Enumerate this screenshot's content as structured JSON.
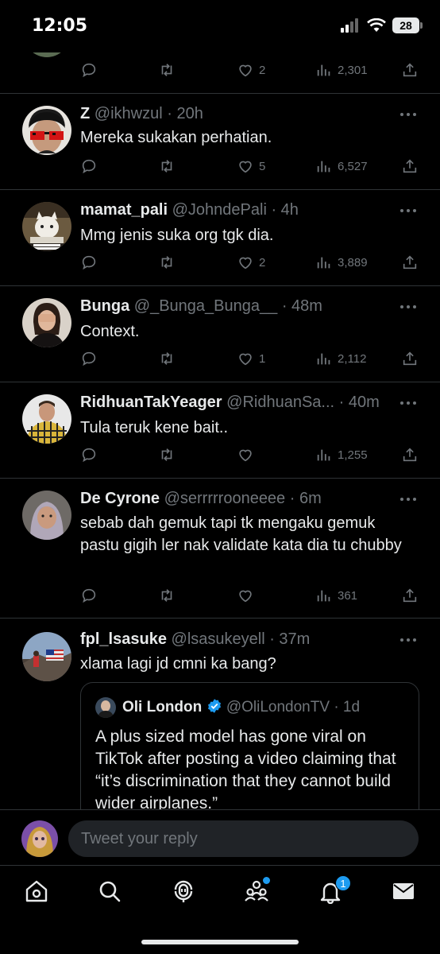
{
  "status": {
    "time": "12:05",
    "battery": "28"
  },
  "top_tweet": {
    "likes": "2",
    "views": "2,301"
  },
  "tweets": [
    {
      "name": "Z",
      "handle": "@ikhwzul",
      "time": "· 20h",
      "text": "Mereka sukakan perhatian.",
      "likes": "5",
      "views": "6,527"
    },
    {
      "name": "mamat_pali",
      "handle": "@JohndePali",
      "time": "· 4h",
      "text": "Mmg jenis suka org tgk dia.",
      "likes": "2",
      "views": "3,889"
    },
    {
      "name": "Bunga",
      "handle": "@_Bunga_Bunga__",
      "time": "· 48m",
      "text": "Context.",
      "likes": "1",
      "views": "2,112"
    },
    {
      "name": "RidhuanTakYeager",
      "handle": "@RidhuanSa...",
      "time": "· 40m",
      "text": "Tula teruk kene bait..",
      "likes": "",
      "views": "1,255"
    },
    {
      "name": "De Cyrone",
      "handle": "@serrrrrooneeee",
      "time": "· 6m",
      "text": "sebab dah gemuk tapi tk mengaku gemuk pastu gigih ler nak validate kata dia tu chubby",
      "likes": "",
      "views": "361"
    },
    {
      "name": "fpl_lsasuke",
      "handle": "@lsasukeyell",
      "time": "· 37m",
      "text": "xlama lagi jd cmni ka bang?"
    }
  ],
  "quote": {
    "name": "Oli London",
    "handle": "@OliLondonTV",
    "time": "· 1d",
    "text": "A plus sized model has gone viral on TikTok after posting a video claiming that “it’s discrimination that they cannot build wider airplanes.”"
  },
  "reply": {
    "placeholder": "Tweet your reply"
  },
  "tabbar": {
    "notifications_badge": "1"
  },
  "colors": {
    "accent": "#1d9bf0",
    "muted": "#71767b",
    "text": "#e7e9ea",
    "divider": "#2f3336"
  },
  "icons": [
    "reply-icon",
    "retweet-icon",
    "like-icon",
    "views-icon",
    "share-icon",
    "more-icon",
    "verified-icon",
    "home-icon",
    "search-icon",
    "spaces-icon",
    "communities-icon",
    "notifications-icon",
    "messages-icon"
  ]
}
